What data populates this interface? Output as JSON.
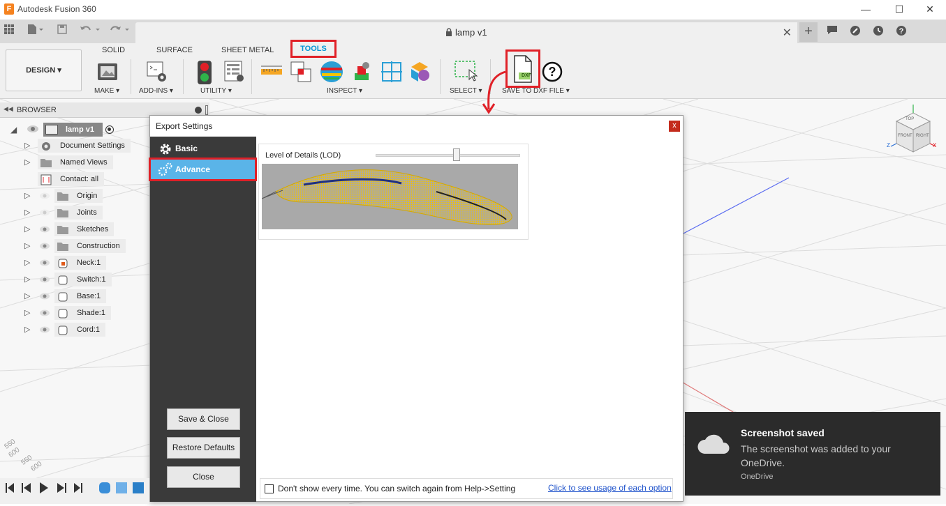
{
  "app": {
    "title": "Autodesk Fusion 360",
    "icon_letter": "F"
  },
  "window_controls": {
    "minimize": "—",
    "maximize": "☐",
    "close": "✕"
  },
  "document_tab": {
    "title": "lamp v1",
    "close": "✕"
  },
  "ribbon": {
    "workspace": "DESIGN",
    "tabs": [
      "SOLID",
      "SURFACE",
      "SHEET METAL",
      "TOOLS"
    ],
    "active_tab": "TOOLS",
    "groups": {
      "make": "MAKE",
      "addins": "ADD-INS",
      "utility": "UTILITY",
      "inspect": "INSPECT",
      "select": "SELECT",
      "save_dxf": "SAVE TO DXF FILE"
    },
    "dxf_icon_text": "DXF"
  },
  "browser": {
    "title": "BROWSER",
    "root": "lamp v1",
    "items": [
      {
        "label": "Document Settings",
        "icon": "gear-icon"
      },
      {
        "label": "Named Views",
        "icon": "folder-icon"
      },
      {
        "label": "Contact: all",
        "icon": "contact-icon"
      },
      {
        "label": "Origin",
        "icon": "folder-icon"
      },
      {
        "label": "Joints",
        "icon": "folder-icon"
      },
      {
        "label": "Sketches",
        "icon": "folder-icon"
      },
      {
        "label": "Construction",
        "icon": "folder-icon"
      },
      {
        "label": "Neck:1",
        "icon": "component-icon"
      },
      {
        "label": "Switch:1",
        "icon": "component-icon"
      },
      {
        "label": "Base:1",
        "icon": "component-icon"
      },
      {
        "label": "Shade:1",
        "icon": "component-icon"
      },
      {
        "label": "Cord:1",
        "icon": "component-icon"
      }
    ]
  },
  "dialog": {
    "title": "Export Settings",
    "close": "x",
    "nav": {
      "basic": "Basic",
      "advance": "Advance"
    },
    "lod_label": "Level of Details (LOD)",
    "lod_value": 0.56,
    "buttons": {
      "save_close": "Save & Close",
      "restore": "Restore Defaults",
      "close": "Close"
    },
    "footer_text": "Don't show every time. You can switch again from Help->Setting",
    "footer_link": "Click to see usage of each option"
  },
  "viewcube": {
    "top": "TOP",
    "front": "FRONT",
    "right": "RIGHT"
  },
  "axis_labels": {
    "z": "Z",
    "x": "X"
  },
  "grid_numbers": [
    "550",
    "600",
    "550",
    "600"
  ],
  "toast": {
    "title": "Screenshot saved",
    "body": "The screenshot was added to your OneDrive.",
    "source": "OneDrive"
  },
  "colors": {
    "highlight_red": "#e02027",
    "accent_blue": "#0696d7",
    "side_active": "#5ab4e8"
  }
}
